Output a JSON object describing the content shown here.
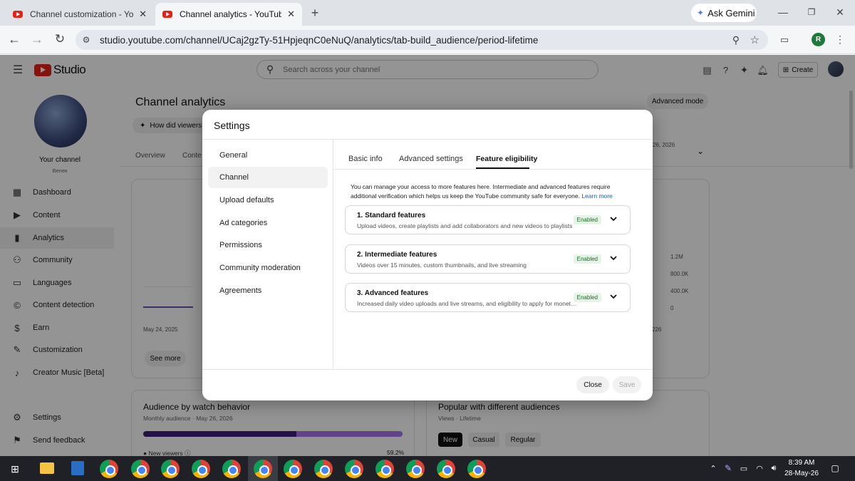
{
  "browser": {
    "tabs": [
      {
        "title": "Channel customization - YouTube Studio",
        "active": false
      },
      {
        "title": "Channel analytics - YouTube Studio",
        "active": true
      }
    ],
    "new_tab_icon": "plus-icon",
    "gemini_label": "Ask Gemini",
    "url": "studio.youtube.com/channel/UCaj2gzTy-51HpjeqnC0eNuQ/analytics/tab-build_audience/period-lifetime",
    "profile_initial": "R"
  },
  "studio": {
    "logo_text": "Studio",
    "search_placeholder": "Search across your channel",
    "create_label": "Create",
    "channel_label": "Your channel",
    "channel_handle": "Bеnек",
    "nav": [
      "Dashboard",
      "Content",
      "Analytics",
      "Community",
      "Languages",
      "Content detection",
      "Earn",
      "Customization",
      "Creator Music [Beta]"
    ],
    "nav_bottom": [
      "Settings",
      "Send feedback"
    ],
    "page_title": "Channel analytics",
    "advanced_mode": "Advanced mode",
    "chip_label": "How did viewers f",
    "tabs": [
      "Overview",
      "Conte"
    ],
    "date_snip": "26, 2026",
    "chart_y_ticks": [
      "1.2M",
      "800.0K",
      "400.0K",
      "0"
    ],
    "chart_x_left": "May 24, 2025",
    "chart_x_right": "226",
    "see_more": "See more",
    "audience_title": "Audience by watch behavior",
    "audience_sub": "Monthly audience · May 26, 2026",
    "new_viewers": "New viewers",
    "new_viewers_pct": "59.2%",
    "new_viewers_share": 0.592,
    "popular_title": "Popular with different audiences",
    "popular_sub": "Views · Lifetime",
    "popular_chips": [
      "New",
      "Casual",
      "Regular"
    ]
  },
  "modal": {
    "title": "Settings",
    "menu": [
      "General",
      "Channel",
      "Upload defaults",
      "Ad categories",
      "Permissions",
      "Community moderation",
      "Agreements"
    ],
    "selected_menu": "Channel",
    "tabs": [
      "Basic info",
      "Advanced settings",
      "Feature eligibility"
    ],
    "active_tab": "Feature eligibility",
    "intro": "You can manage your access to more features here. Intermediate and advanced features require additional verification which helps us keep the YouTube community safe for everyone.",
    "learn_more": "Learn more",
    "features": [
      {
        "title": "1. Standard features",
        "desc": "Upload videos, create playlists and add collaborators and new videos to playlists",
        "status": "Enabled"
      },
      {
        "title": "2. Intermediate features",
        "desc": "Videos over 15 minutes, custom thumbnails, and live streaming",
        "status": "Enabled"
      },
      {
        "title": "3. Advanced features",
        "desc": "Increased daily video uploads and live streams, and eligibility to apply for monetization",
        "status": "Enabled"
      }
    ],
    "close_label": "Close",
    "save_label": "Save"
  },
  "taskbar": {
    "time": "8:39 AM",
    "date": "28-May-26"
  },
  "colors": {
    "yt_red": "#e62117",
    "enabled_badge_bg": "#e6f4e7",
    "link_blue": "#065fd4",
    "taskbar_bg": "#1f2126"
  }
}
